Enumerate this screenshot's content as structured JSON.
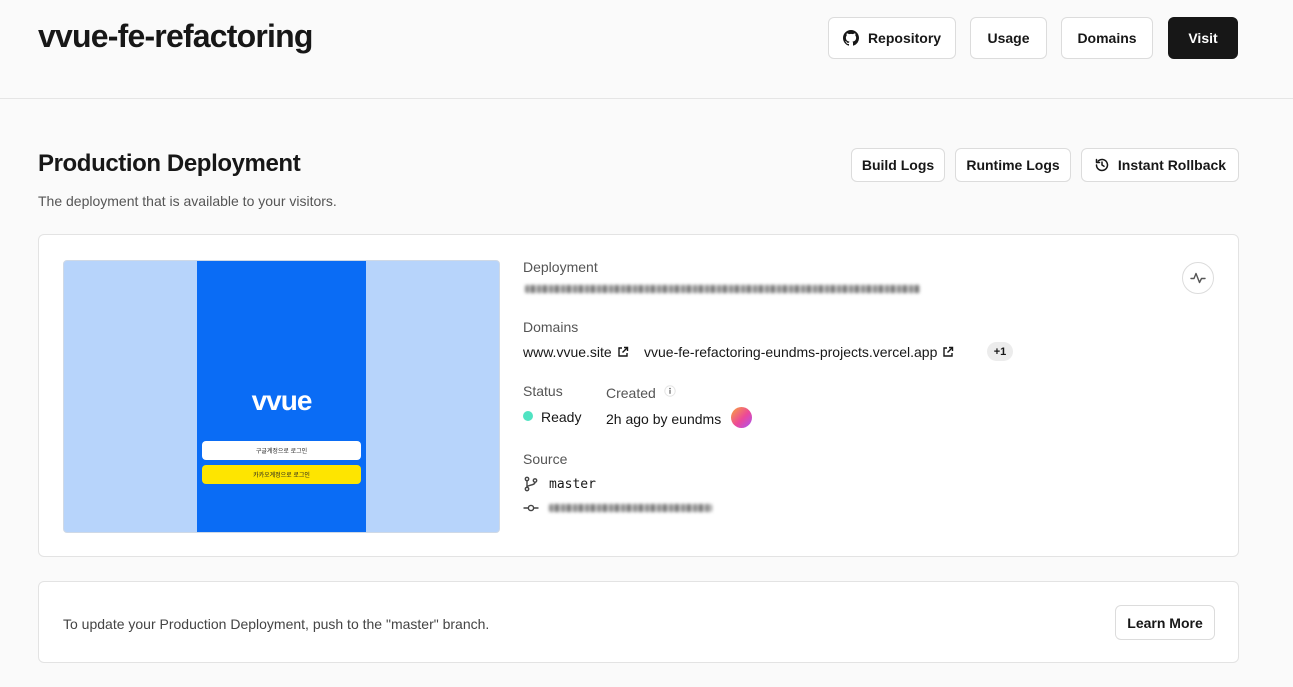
{
  "header": {
    "title": "vvue-fe-refactoring",
    "repository_label": "Repository",
    "usage_label": "Usage",
    "domains_label": "Domains",
    "visit_label": "Visit"
  },
  "production": {
    "title": "Production Deployment",
    "subtitle": "The deployment that is available to your visitors.",
    "build_logs_label": "Build Logs",
    "runtime_logs_label": "Runtime Logs",
    "rollback_label": "Instant Rollback"
  },
  "preview": {
    "logo_text": "vvue",
    "google_login": "구글계정으로 로그인",
    "kakao_login": "카카오계정으로 로그인"
  },
  "deployment": {
    "deployment_label": "Deployment",
    "domains_label": "Domains",
    "domain_1": "www.vvue.site",
    "domain_2": "vvue-fe-refactoring-eundms-projects.vercel.app",
    "more_domains": "+1",
    "status_label": "Status",
    "status_value": "Ready",
    "status_color": "#50e3c2",
    "created_label": "Created",
    "created_value": "2h ago by eundms",
    "source_label": "Source",
    "branch": "master"
  },
  "info": {
    "text": "To update your Production Deployment, push to the \"master\" branch.",
    "learn_more_label": "Learn More"
  },
  "icons": [
    "github-icon",
    "external-link-icon",
    "rollback-icon",
    "info-icon",
    "git-branch-icon",
    "git-commit-icon",
    "activity-icon"
  ]
}
